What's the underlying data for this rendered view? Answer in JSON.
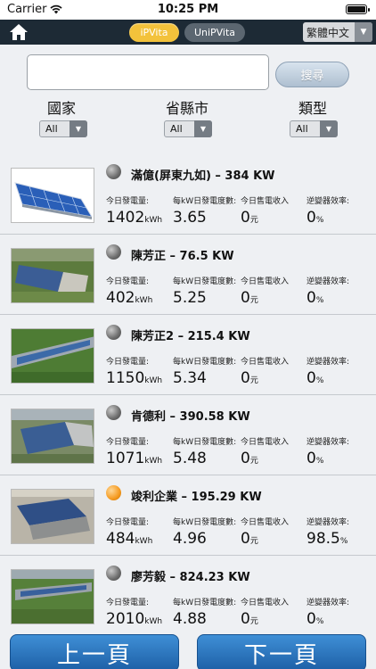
{
  "status": {
    "carrier": "Carrier",
    "time": "10:25 PM"
  },
  "navbar": {
    "tab_ipvita": "iPVita",
    "tab_unipvita": "UniPVita",
    "language": "繁體中文"
  },
  "search": {
    "value": "",
    "placeholder": "",
    "button": "搜尋"
  },
  "filters": [
    {
      "label": "國家",
      "selected": "All"
    },
    {
      "label": "省縣市",
      "selected": "All"
    },
    {
      "label": "類型",
      "selected": "All"
    }
  ],
  "metric_labels": {
    "today_gen": "今日發電量:",
    "per_kw": "每kW日發電度數:",
    "today_income": "今日售電收入",
    "inverter_eff": "逆變器效率:"
  },
  "units": {
    "kwh": "kWh",
    "yuan": "元",
    "percent": "%"
  },
  "stations": [
    {
      "name": "滿億(屏東九如) – 384 KW",
      "status": "off",
      "today_gen": "1402",
      "per_kw": "3.65",
      "income": "0",
      "efficiency": "0"
    },
    {
      "name": "陳芳正 – 76.5 KW",
      "status": "off",
      "today_gen": "402",
      "per_kw": "5.25",
      "income": "0",
      "efficiency": "0"
    },
    {
      "name": "陳芳正2 – 215.4 KW",
      "status": "off",
      "today_gen": "1150",
      "per_kw": "5.34",
      "income": "0",
      "efficiency": "0"
    },
    {
      "name": "肯德利 – 390.58 KW",
      "status": "off",
      "today_gen": "1071",
      "per_kw": "5.48",
      "income": "0",
      "efficiency": "0"
    },
    {
      "name": "竣利企業 – 195.29 KW",
      "status": "on",
      "today_gen": "484",
      "per_kw": "4.96",
      "income": "0",
      "efficiency": "98.5"
    },
    {
      "name": "廖芳毅 – 824.23 KW",
      "status": "off",
      "today_gen": "2010",
      "per_kw": "4.88",
      "income": "0",
      "efficiency": "0"
    }
  ],
  "pager": {
    "prev": "上一頁",
    "next": "下一頁"
  },
  "colors": {
    "navbar": "#1d2a35",
    "accent": "#f3c23b",
    "button_blue": "#2f7ac4"
  }
}
